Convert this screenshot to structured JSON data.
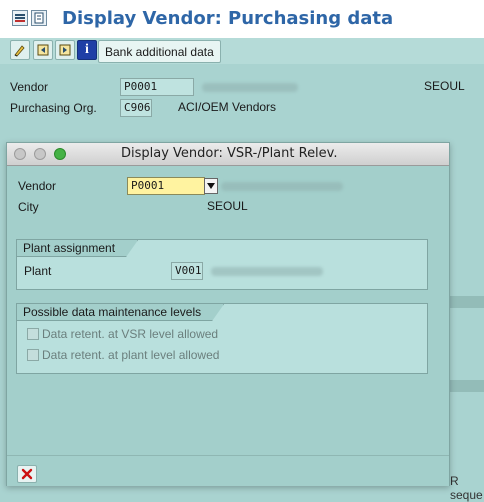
{
  "window": {
    "title": "Display Vendor: Purchasing data"
  },
  "toolbar": {
    "bank_button_label": "Bank additional data"
  },
  "main": {
    "vendor_label": "Vendor",
    "vendor_value": "P0001",
    "vendor_city": "SEOUL",
    "purch_org_label": "Purchasing Org.",
    "purch_org_value": "C906",
    "purch_org_name": "ACI/OEM Vendors",
    "partial_text": "R seque"
  },
  "dialog": {
    "title": "Display Vendor: VSR-/Plant Relev.",
    "vendor_label": "Vendor",
    "vendor_value": "P0001",
    "city_label": "City",
    "city_value": "SEOUL",
    "plant_assignment": {
      "title": "Plant assignment",
      "plant_label": "Plant",
      "plant_value": "V001"
    },
    "maintenance_levels": {
      "title": "Possible data maintenance levels",
      "option_vsr": "Data retent. at VSR level allowed",
      "option_plant": "Data retent. at plant level allowed"
    }
  },
  "colors": {
    "title_blue": "#2e66a7",
    "background": "#a9d3d0",
    "input_highlight": "#fff3a0",
    "cancel_red": "#cc1111"
  },
  "icons": [
    "menu-icon",
    "list-icon",
    "change-icon",
    "previous-icon",
    "next-icon",
    "info-icon",
    "dropdown-arrow-icon",
    "cancel-icon"
  ]
}
